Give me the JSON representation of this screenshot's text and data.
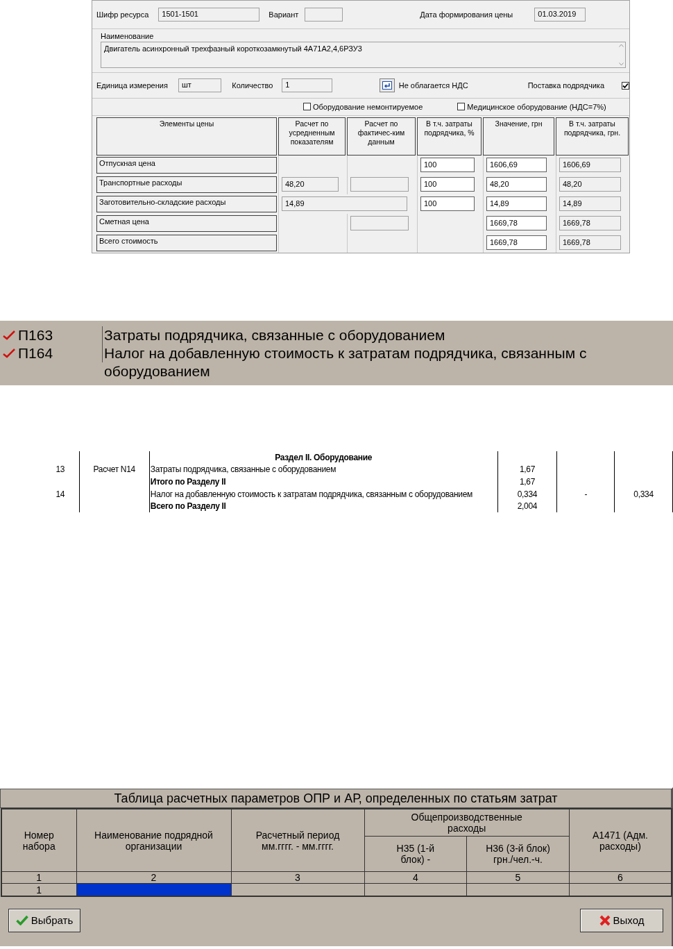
{
  "price_form": {
    "resource_code": {
      "label": "Шифр ресурса",
      "value": "1501-1501"
    },
    "variant": {
      "label": "Вариант"
    },
    "price_date": {
      "label": "Дата формирования цены",
      "value": "01.03.2019"
    },
    "name": {
      "label": "Наименование",
      "value": "Двигатель асинхронный трехфазный короткозамкнутый 4А71А2,4,6РЗУ3"
    },
    "unit": {
      "label": "Единица измерения",
      "value": "шт"
    },
    "quantity": {
      "label": "Количество",
      "value": "1"
    },
    "vat_exempt_label": "Не облагается НДС",
    "contractor_supply": {
      "label": "Поставка подрядчика",
      "checked": true
    },
    "options": [
      {
        "label": "Оборудование немонтируемое",
        "checked": false
      },
      {
        "label": "Медицинское оборудование (НДС=7%)",
        "checked": false
      }
    ],
    "table": {
      "columns": [
        "Элементы цены",
        "Расчет по усредненным показателям",
        "Расчет по фактичес-ким данным",
        "В т.ч. затраты подрядчика, %",
        "Значение, грн",
        "В т.ч. затраты подрядчика, грн."
      ],
      "rows": [
        {
          "cells": [
            {
              "kind": "label",
              "value": "Отпускная цена"
            },
            {
              "kind": "empty"
            },
            {
              "kind": "empty"
            },
            {
              "kind": "input",
              "value": "100"
            },
            {
              "kind": "input",
              "value": "1606,69"
            },
            {
              "kind": "readonly",
              "value": "1606,69"
            }
          ]
        },
        {
          "cells": [
            {
              "kind": "label",
              "value": "Транспортные расходы"
            },
            {
              "kind": "readonly",
              "value": "48,20"
            },
            {
              "kind": "readonly"
            },
            {
              "kind": "input",
              "value": "100"
            },
            {
              "kind": "input",
              "value": "48,20"
            },
            {
              "kind": "readonly",
              "value": "48,20"
            }
          ]
        },
        {
          "cells": [
            {
              "kind": "label",
              "value": "Заготовительно-складские расходы"
            },
            {
              "kind": "wide",
              "value": "14,89"
            },
            {
              "kind": "merged"
            },
            {
              "kind": "input",
              "value": "100"
            },
            {
              "kind": "input",
              "value": "14,89"
            },
            {
              "kind": "readonly",
              "value": "14,89"
            }
          ]
        },
        {
          "cells": [
            {
              "kind": "label",
              "value": "Сметная цена"
            },
            {
              "kind": "empty"
            },
            {
              "kind": "readonly"
            },
            {
              "kind": "empty"
            },
            {
              "kind": "input",
              "value": "1669,78"
            },
            {
              "kind": "readonly",
              "value": "1669,78"
            }
          ]
        },
        {
          "cells": [
            {
              "kind": "label",
              "value": "Всего стоимость"
            },
            {
              "kind": "empty"
            },
            {
              "kind": "empty"
            },
            {
              "kind": "empty"
            },
            {
              "kind": "input",
              "value": "1669,78"
            },
            {
              "kind": "readonly",
              "value": "1669,78"
            }
          ]
        }
      ]
    }
  },
  "cost_items": [
    {
      "code": "П163",
      "text": "Затраты подрядчика, связанные  с оборудованием",
      "checked": true
    },
    {
      "code": "П164",
      "text": "Налог на добавленную стоимость к затратам подрядчика, связанным с оборудованием",
      "checked": true
    }
  ],
  "report": {
    "rows": [
      {
        "kind": "heading",
        "name": "Раздел II. Оборудование"
      },
      {
        "kind": "item",
        "number": "13",
        "basis": "Расчет N14",
        "name": "Затраты подрядчика, связанные  с оборудованием",
        "value": "1,67"
      },
      {
        "kind": "total",
        "name": "Итого по Разделу II",
        "value": "1,67"
      },
      {
        "kind": "item",
        "number": "14",
        "name": "Налог на добавленную стоимость к затратам подрядчика, связанным с оборудованием",
        "value": "0,334",
        "column_5": "-",
        "column_6": "0,334"
      },
      {
        "kind": "total",
        "name": "Всего по Разделу II",
        "value": "2,004"
      }
    ]
  },
  "params_dialog": {
    "title": "Таблица расчетных параметров ОПР и АР, определенных по статьям затрат",
    "headers": {
      "set_number": "Номер набора",
      "organization": "Наименование подрядной организации",
      "period": "Расчетный период мм.гггг. - мм.гггг.",
      "overhead_group": "Общепроизводственные расходы",
      "h35": "Н35 (1-й блок) -",
      "h36": "Н36 (3-й блок) грн./чел.-ч.",
      "a1471": "А1471 (Адм. расходы)"
    },
    "column_numbers": [
      "1",
      "2",
      "3",
      "4",
      "5",
      "6"
    ],
    "rows": [
      {
        "cells": [
          {
            "text": "1",
            "selected": false
          },
          {
            "selected": true
          },
          {
            "selected": false
          },
          {
            "selected": false
          },
          {
            "selected": false
          },
          {
            "selected": false
          }
        ]
      }
    ],
    "buttons": [
      {
        "label": "Выбрать",
        "kind": "ok"
      },
      {
        "label": "Выход",
        "kind": "cancel"
      }
    ]
  }
}
